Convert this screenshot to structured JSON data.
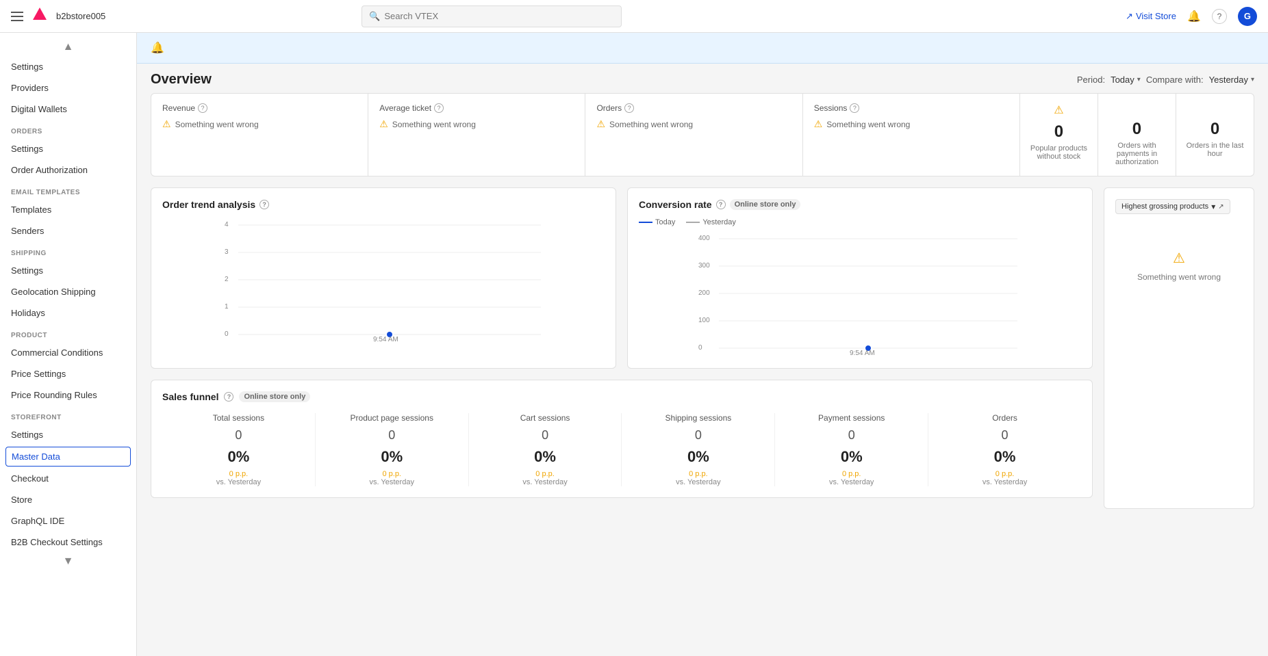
{
  "topNav": {
    "storeName": "b2bstore005",
    "searchPlaceholder": "Search VTEX",
    "visitStoreLabel": "Visit Store",
    "avatarInitial": "G"
  },
  "sidebar": {
    "scrollUpLabel": "▲",
    "scrollDownLabel": "▼",
    "topItems": [
      {
        "label": "Settings",
        "id": "settings-top"
      },
      {
        "label": "Providers",
        "id": "providers"
      },
      {
        "label": "Digital Wallets",
        "id": "digital-wallets"
      }
    ],
    "sections": [
      {
        "label": "ORDERS",
        "items": [
          {
            "label": "Settings",
            "id": "orders-settings"
          },
          {
            "label": "Order Authorization",
            "id": "order-authorization"
          }
        ]
      },
      {
        "label": "EMAIL TEMPLATES",
        "items": [
          {
            "label": "Templates",
            "id": "templates"
          },
          {
            "label": "Senders",
            "id": "senders"
          }
        ]
      },
      {
        "label": "SHIPPING",
        "items": [
          {
            "label": "Settings",
            "id": "shipping-settings"
          },
          {
            "label": "Geolocation Shipping",
            "id": "geolocation-shipping"
          },
          {
            "label": "Holidays",
            "id": "holidays"
          }
        ]
      },
      {
        "label": "PRODUCT",
        "items": [
          {
            "label": "Commercial Conditions",
            "id": "commercial-conditions"
          },
          {
            "label": "Price Settings",
            "id": "price-settings"
          },
          {
            "label": "Price Rounding Rules",
            "id": "price-rounding-rules"
          }
        ]
      },
      {
        "label": "STOREFRONT",
        "items": [
          {
            "label": "Settings",
            "id": "storefront-settings"
          },
          {
            "label": "Master Data",
            "id": "master-data",
            "active": true
          },
          {
            "label": "Checkout",
            "id": "checkout"
          },
          {
            "label": "Store",
            "id": "store"
          },
          {
            "label": "GraphQL IDE",
            "id": "graphql-ide"
          },
          {
            "label": "B2B Checkout Settings",
            "id": "b2b-checkout-settings"
          }
        ]
      }
    ]
  },
  "overview": {
    "title": "Overview",
    "periodLabel": "Period:",
    "periodValue": "Today",
    "compareLabel": "Compare with:",
    "compareValue": "Yesterday"
  },
  "metrics": [
    {
      "label": "Revenue",
      "error": "Something went wrong"
    },
    {
      "label": "Average ticket",
      "error": "Something went wrong"
    },
    {
      "label": "Orders",
      "error": "Something went wrong"
    },
    {
      "label": "Sessions",
      "error": "Something went wrong"
    }
  ],
  "metricCards": [
    {
      "label": "Popular products without stock",
      "value": "0"
    },
    {
      "label": "Orders with payments in authorization",
      "value": "0"
    },
    {
      "label": "Orders in the last hour",
      "value": "0"
    }
  ],
  "orderTrend": {
    "title": "Order trend analysis",
    "yLabels": [
      "4",
      "3",
      "2",
      "1",
      "0"
    ],
    "xLabel": "9:54 AM",
    "dotX": 479,
    "dotY": 178
  },
  "conversionRate": {
    "title": "Conversion rate",
    "badge": "Online store only",
    "legendToday": "Today",
    "legendYesterday": "Yesterday",
    "yLabels": [
      "400",
      "300",
      "200",
      "100",
      "0"
    ],
    "xLabel": "9:54 AM",
    "dotX": 245,
    "dotY": 178
  },
  "highestGrossing": {
    "title": "Highest grossing products",
    "dropdownLabel": "Highest grossing products",
    "error": "Something went wrong"
  },
  "salesFunnel": {
    "title": "Sales funnel",
    "badge": "Online store only",
    "columns": [
      {
        "label": "Total sessions",
        "value": "0",
        "pct": "0%",
        "pp": "0 p.p.",
        "vs": "vs. Yesterday"
      },
      {
        "label": "Product page sessions",
        "value": "0",
        "pct": "0%",
        "pp": "0 p.p.",
        "vs": "vs. Yesterday"
      },
      {
        "label": "Cart sessions",
        "value": "0",
        "pct": "0%",
        "pp": "0 p.p.",
        "vs": "vs. Yesterday"
      },
      {
        "label": "Shipping sessions",
        "value": "0",
        "pct": "0%",
        "pp": "0 p.p.",
        "vs": "vs. Yesterday"
      },
      {
        "label": "Payment sessions",
        "value": "0",
        "pct": "0%",
        "pp": "0 p.p.",
        "vs": "vs. Yesterday"
      },
      {
        "label": "Orders",
        "value": "0",
        "pct": "0%",
        "pp": "0 p.p.",
        "vs": "vs. Yesterday"
      }
    ]
  },
  "icons": {
    "hamburger": "☰",
    "search": "🔍",
    "bell": "🔔",
    "help": "?",
    "warning": "⚠",
    "caretDown": "▾",
    "arrowUpRight": "↗",
    "helpCircle": "?"
  }
}
